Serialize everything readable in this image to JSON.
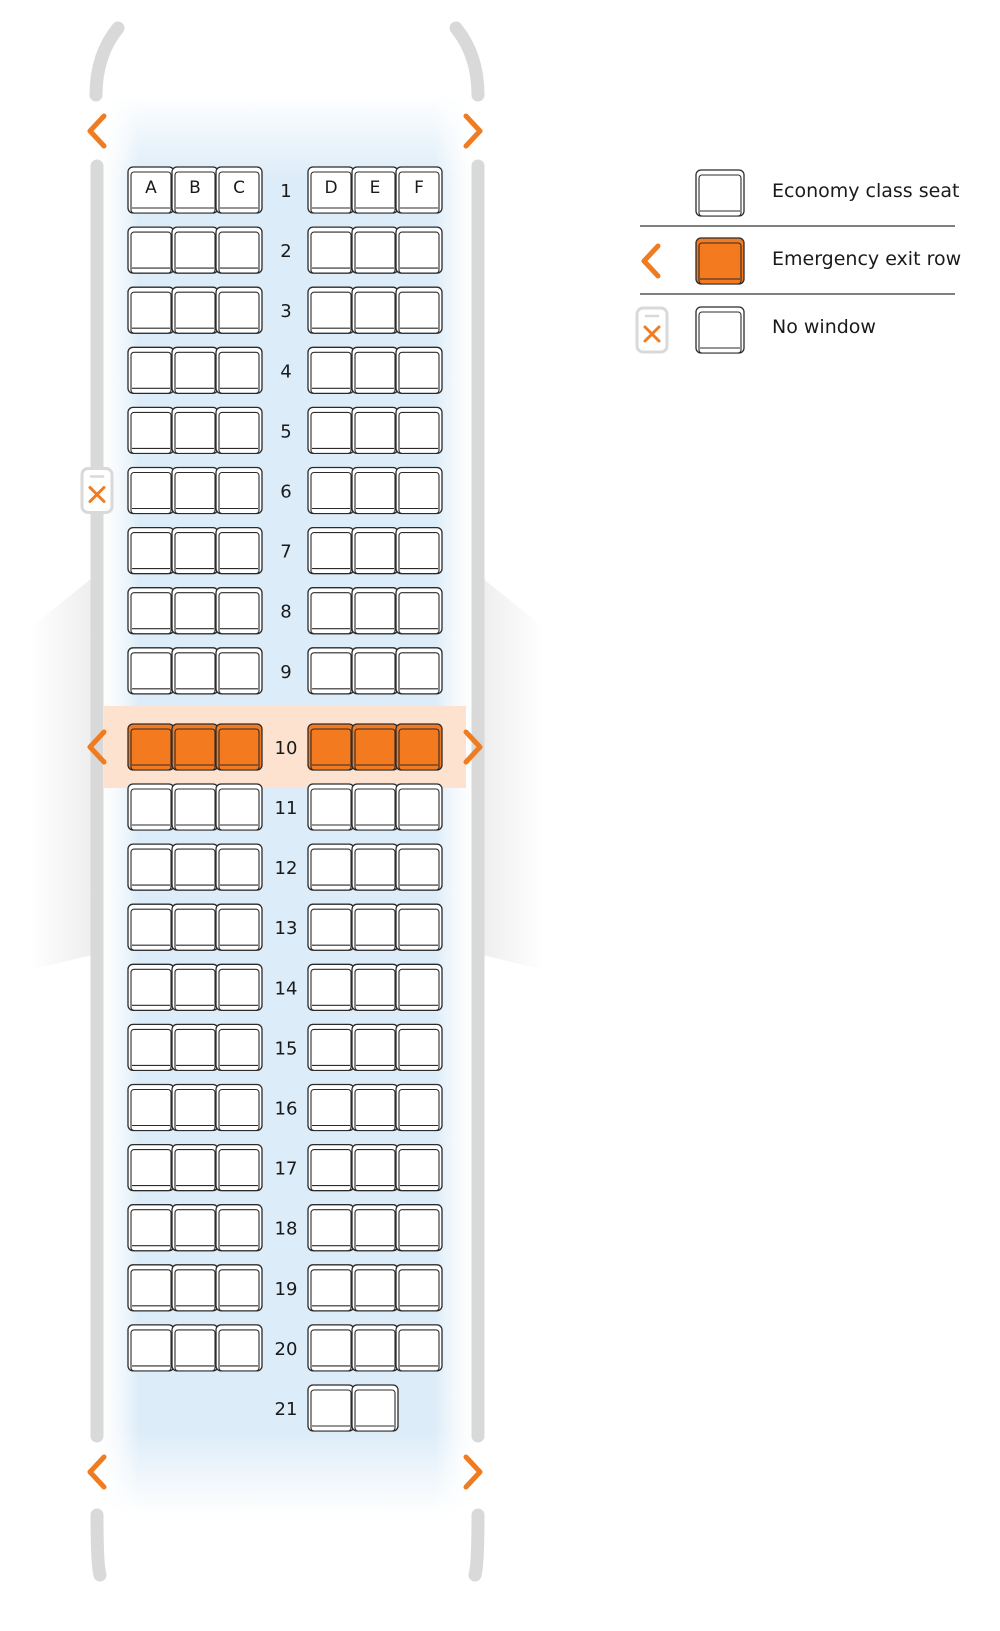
{
  "colors": {
    "seat_fill": "#ffffff",
    "seat_stroke": "#2b2b2b",
    "exit_seat_fill": "#f47a20",
    "exit_row_highlight": "#fde3cf",
    "accent": "#f07c22",
    "cabin_glow": "#dcecf8",
    "fuselage_gray": "#d9d9d9",
    "wing_gray": "#f1f1f1"
  },
  "seatmap": {
    "columns_left": [
      "A",
      "B",
      "C"
    ],
    "columns_right": [
      "D",
      "E",
      "F"
    ],
    "rows": [
      {
        "number": "1",
        "left": [
          "A",
          "B",
          "C"
        ],
        "right": [
          "D",
          "E",
          "F"
        ],
        "exit": false,
        "header": true
      },
      {
        "number": "2",
        "left": [
          "A",
          "B",
          "C"
        ],
        "right": [
          "D",
          "E",
          "F"
        ],
        "exit": false
      },
      {
        "number": "3",
        "left": [
          "A",
          "B",
          "C"
        ],
        "right": [
          "D",
          "E",
          "F"
        ],
        "exit": false
      },
      {
        "number": "4",
        "left": [
          "A",
          "B",
          "C"
        ],
        "right": [
          "D",
          "E",
          "F"
        ],
        "exit": false
      },
      {
        "number": "5",
        "left": [
          "A",
          "B",
          "C"
        ],
        "right": [
          "D",
          "E",
          "F"
        ],
        "exit": false
      },
      {
        "number": "6",
        "left": [
          "A",
          "B",
          "C"
        ],
        "right": [
          "D",
          "E",
          "F"
        ],
        "exit": false,
        "no_window": "left"
      },
      {
        "number": "7",
        "left": [
          "A",
          "B",
          "C"
        ],
        "right": [
          "D",
          "E",
          "F"
        ],
        "exit": false
      },
      {
        "number": "8",
        "left": [
          "A",
          "B",
          "C"
        ],
        "right": [
          "D",
          "E",
          "F"
        ],
        "exit": false
      },
      {
        "number": "9",
        "left": [
          "A",
          "B",
          "C"
        ],
        "right": [
          "D",
          "E",
          "F"
        ],
        "exit": false
      },
      {
        "number": "10",
        "left": [
          "A",
          "B",
          "C"
        ],
        "right": [
          "D",
          "E",
          "F"
        ],
        "exit": true
      },
      {
        "number": "11",
        "left": [
          "A",
          "B",
          "C"
        ],
        "right": [
          "D",
          "E",
          "F"
        ],
        "exit": false
      },
      {
        "number": "12",
        "left": [
          "A",
          "B",
          "C"
        ],
        "right": [
          "D",
          "E",
          "F"
        ],
        "exit": false
      },
      {
        "number": "13",
        "left": [
          "A",
          "B",
          "C"
        ],
        "right": [
          "D",
          "E",
          "F"
        ],
        "exit": false
      },
      {
        "number": "14",
        "left": [
          "A",
          "B",
          "C"
        ],
        "right": [
          "D",
          "E",
          "F"
        ],
        "exit": false
      },
      {
        "number": "15",
        "left": [
          "A",
          "B",
          "C"
        ],
        "right": [
          "D",
          "E",
          "F"
        ],
        "exit": false
      },
      {
        "number": "16",
        "left": [
          "A",
          "B",
          "C"
        ],
        "right": [
          "D",
          "E",
          "F"
        ],
        "exit": false
      },
      {
        "number": "17",
        "left": [
          "A",
          "B",
          "C"
        ],
        "right": [
          "D",
          "E",
          "F"
        ],
        "exit": false
      },
      {
        "number": "18",
        "left": [
          "A",
          "B",
          "C"
        ],
        "right": [
          "D",
          "E",
          "F"
        ],
        "exit": false
      },
      {
        "number": "19",
        "left": [
          "A",
          "B",
          "C"
        ],
        "right": [
          "D",
          "E",
          "F"
        ],
        "exit": false
      },
      {
        "number": "20",
        "left": [
          "A",
          "B",
          "C"
        ],
        "right": [
          "D",
          "E",
          "F"
        ],
        "exit": false
      },
      {
        "number": "21",
        "left": [],
        "right": [
          "D",
          "E"
        ],
        "exit": false
      }
    ],
    "door_exits": [
      "front",
      "row-10",
      "rear"
    ]
  },
  "legend": {
    "items": [
      {
        "icon": "economy-seat-icon",
        "label": "Economy class seat"
      },
      {
        "icon": "emergency-exit-icon",
        "label": "Emergency exit row"
      },
      {
        "icon": "no-window-icon",
        "label": "No window"
      }
    ]
  }
}
